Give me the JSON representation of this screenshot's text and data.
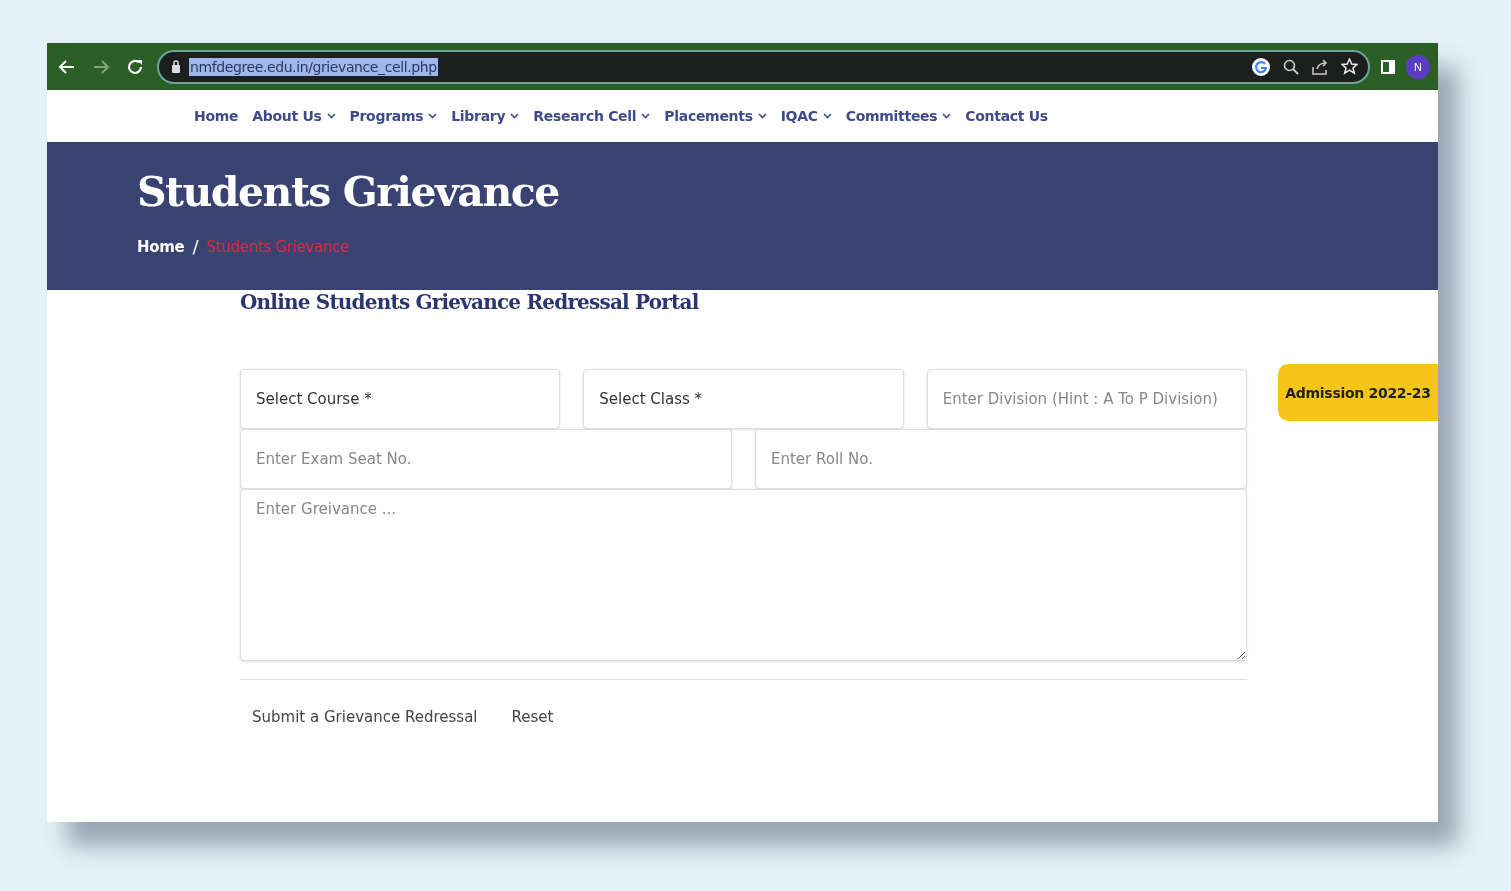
{
  "browser": {
    "url": "nmfdegree.edu.in/grievance_cell.php",
    "url_selected": true,
    "profile_initial": "N"
  },
  "nav": [
    {
      "label": "Home",
      "dropdown": false
    },
    {
      "label": "About Us",
      "dropdown": true
    },
    {
      "label": "Programs",
      "dropdown": true
    },
    {
      "label": "Library",
      "dropdown": true
    },
    {
      "label": "Research Cell",
      "dropdown": true
    },
    {
      "label": "Placements",
      "dropdown": true
    },
    {
      "label": "IQAC",
      "dropdown": true
    },
    {
      "label": "Committees",
      "dropdown": true
    },
    {
      "label": "Contact Us",
      "dropdown": false
    }
  ],
  "banner": {
    "title": "Students Grievance",
    "breadcrumb": [
      {
        "label": "Home",
        "selected": false
      },
      {
        "label": "Students Grievance",
        "selected": true
      }
    ],
    "separator": "/"
  },
  "form": {
    "heading": "Online Students Grievance Redressal Portal",
    "rows": [
      [
        {
          "kind": "select",
          "value": "Select Course *"
        },
        {
          "kind": "select",
          "value": "Select Class *"
        },
        {
          "kind": "input",
          "placeholder": "Enter Division (Hint : A To P Division)"
        }
      ],
      [
        {
          "kind": "input",
          "placeholder": "Enter Exam Seat No."
        },
        {
          "kind": "input",
          "placeholder": "Enter Roll No."
        }
      ],
      [
        {
          "kind": "textarea",
          "placeholder": "Enter Greivance ..."
        }
      ]
    ],
    "buttons": [
      "Submit a Grievance Redressal",
      "Reset"
    ]
  },
  "side_badge": "Admission 2022-23"
}
